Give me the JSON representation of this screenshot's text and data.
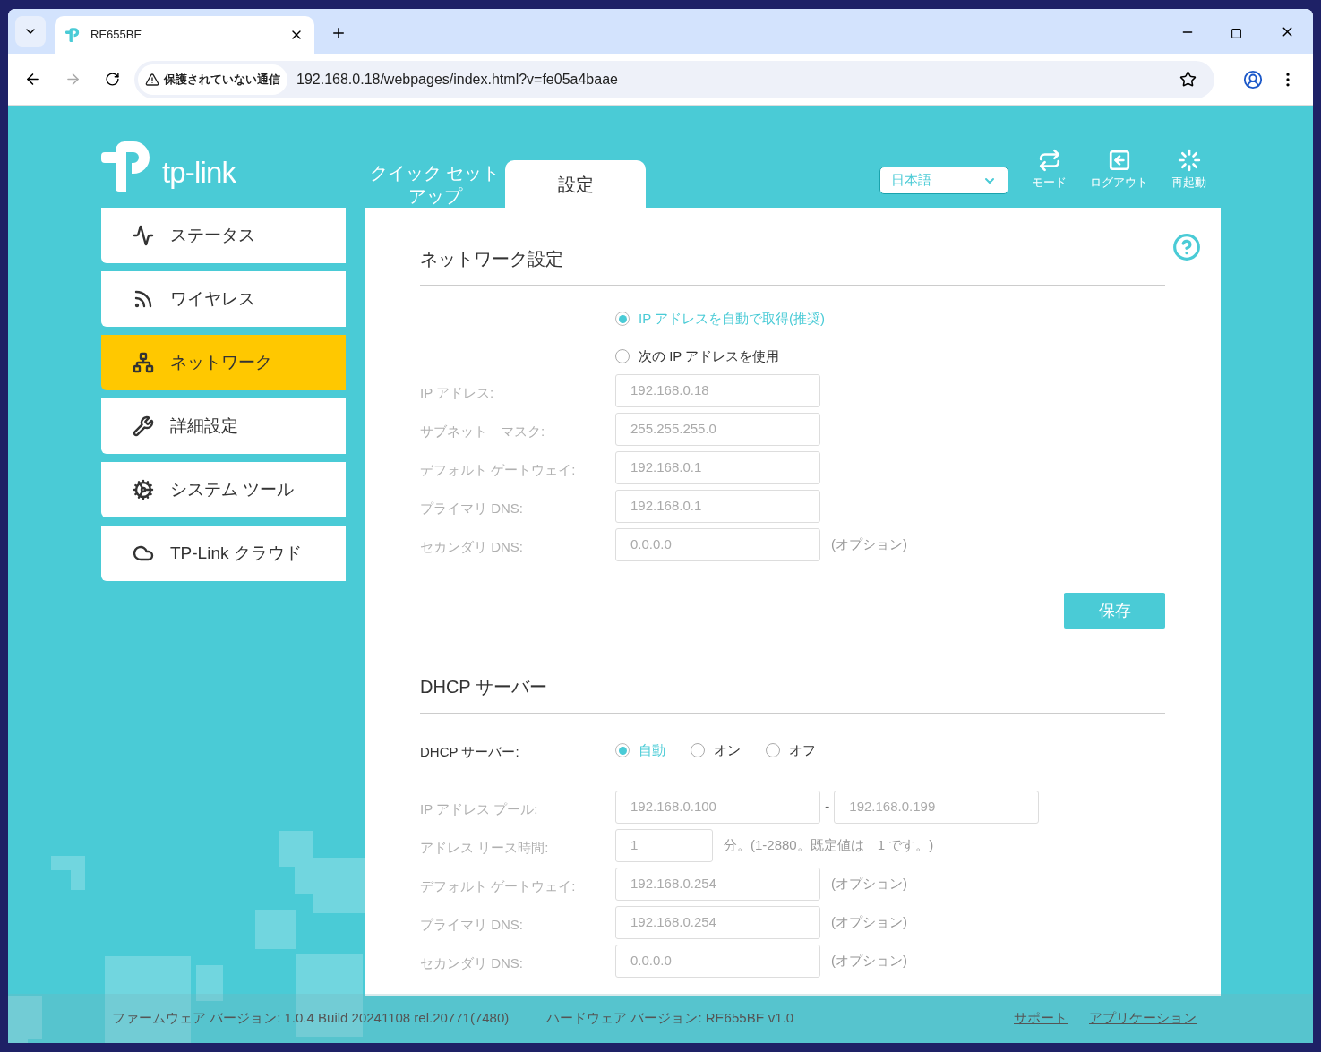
{
  "browser": {
    "tab_title": "RE655BE",
    "security_label": "保護されていない通信",
    "url": "192.168.0.18/webpages/index.html?v=fe05a4baae"
  },
  "header": {
    "brand": "tp-link",
    "tabs": [
      {
        "label": "クイック セットアップ",
        "selected": false
      },
      {
        "label": "設定",
        "selected": true
      }
    ],
    "language": "日本語",
    "actions": [
      {
        "kind": "mode",
        "label": "モード"
      },
      {
        "kind": "logout",
        "label": "ログアウト"
      },
      {
        "kind": "reboot",
        "label": "再起動"
      }
    ]
  },
  "sidebar": {
    "items": [
      {
        "kind": "status",
        "label": "ステータス",
        "selected": false
      },
      {
        "kind": "wireless",
        "label": "ワイヤレス",
        "selected": false
      },
      {
        "kind": "network",
        "label": "ネットワーク",
        "selected": true
      },
      {
        "kind": "advanced",
        "label": "詳細設定",
        "selected": false
      },
      {
        "kind": "system",
        "label": "システム ツール",
        "selected": false
      },
      {
        "kind": "cloud",
        "label": "TP-Link クラウド",
        "selected": false
      }
    ]
  },
  "network": {
    "title": "ネットワーク設定",
    "options": [
      {
        "label": "IP アドレスを自動で取得(推奨)",
        "selected": true
      },
      {
        "label": "次の IP アドレスを使用",
        "selected": false
      }
    ],
    "fields": [
      {
        "kind": "single",
        "label": "IP アドレス:",
        "value": "192.168.0.18",
        "disabled": true
      },
      {
        "kind": "single",
        "label": "サブネット　マスク:",
        "value": "255.255.255.0",
        "disabled": true
      },
      {
        "kind": "single",
        "label": "デフォルト ゲートウェイ:",
        "value": "192.168.0.1",
        "disabled": true
      },
      {
        "kind": "single",
        "label": "プライマリ DNS:",
        "value": "192.168.0.1",
        "disabled": true
      },
      {
        "kind": "single",
        "label": "セカンダリ DNS:",
        "value": "0.0.0.0",
        "note": "(オプション)",
        "disabled": true
      }
    ],
    "save_button": "保存"
  },
  "dhcp": {
    "title": "DHCP サーバー",
    "server_label": "DHCP サーバー:",
    "options": [
      {
        "label": "自動",
        "selected": true
      },
      {
        "label": "オン",
        "selected": false
      },
      {
        "label": "オフ",
        "selected": false
      }
    ],
    "fields": [
      {
        "kind": "range",
        "label": "IP アドレス プール:",
        "value": "192.168.0.100",
        "separator": "-",
        "value_end": "192.168.0.199",
        "disabled": true
      },
      {
        "kind": "short",
        "label": "アドレス リース時間:",
        "value": "1",
        "note": "分。(1-2880。既定値は　1 です。)",
        "disabled": true
      },
      {
        "kind": "single",
        "label": "デフォルト ゲートウェイ:",
        "value": "192.168.0.254",
        "note": "(オプション)",
        "disabled": true
      },
      {
        "kind": "single",
        "label": "プライマリ DNS:",
        "value": "192.168.0.254",
        "note": "(オプション)",
        "disabled": true
      },
      {
        "kind": "single",
        "label": "セカンダリ DNS:",
        "value": "0.0.0.0",
        "note": "(オプション)",
        "disabled": true
      }
    ]
  },
  "footer": {
    "firmware": "ファームウェア バージョン: 1.0.4 Build 20241108 rel.20771(7480)",
    "hardware": "ハードウェア バージョン: RE655BE v1.0",
    "links": [
      "サポート",
      "アプリケーション"
    ]
  }
}
